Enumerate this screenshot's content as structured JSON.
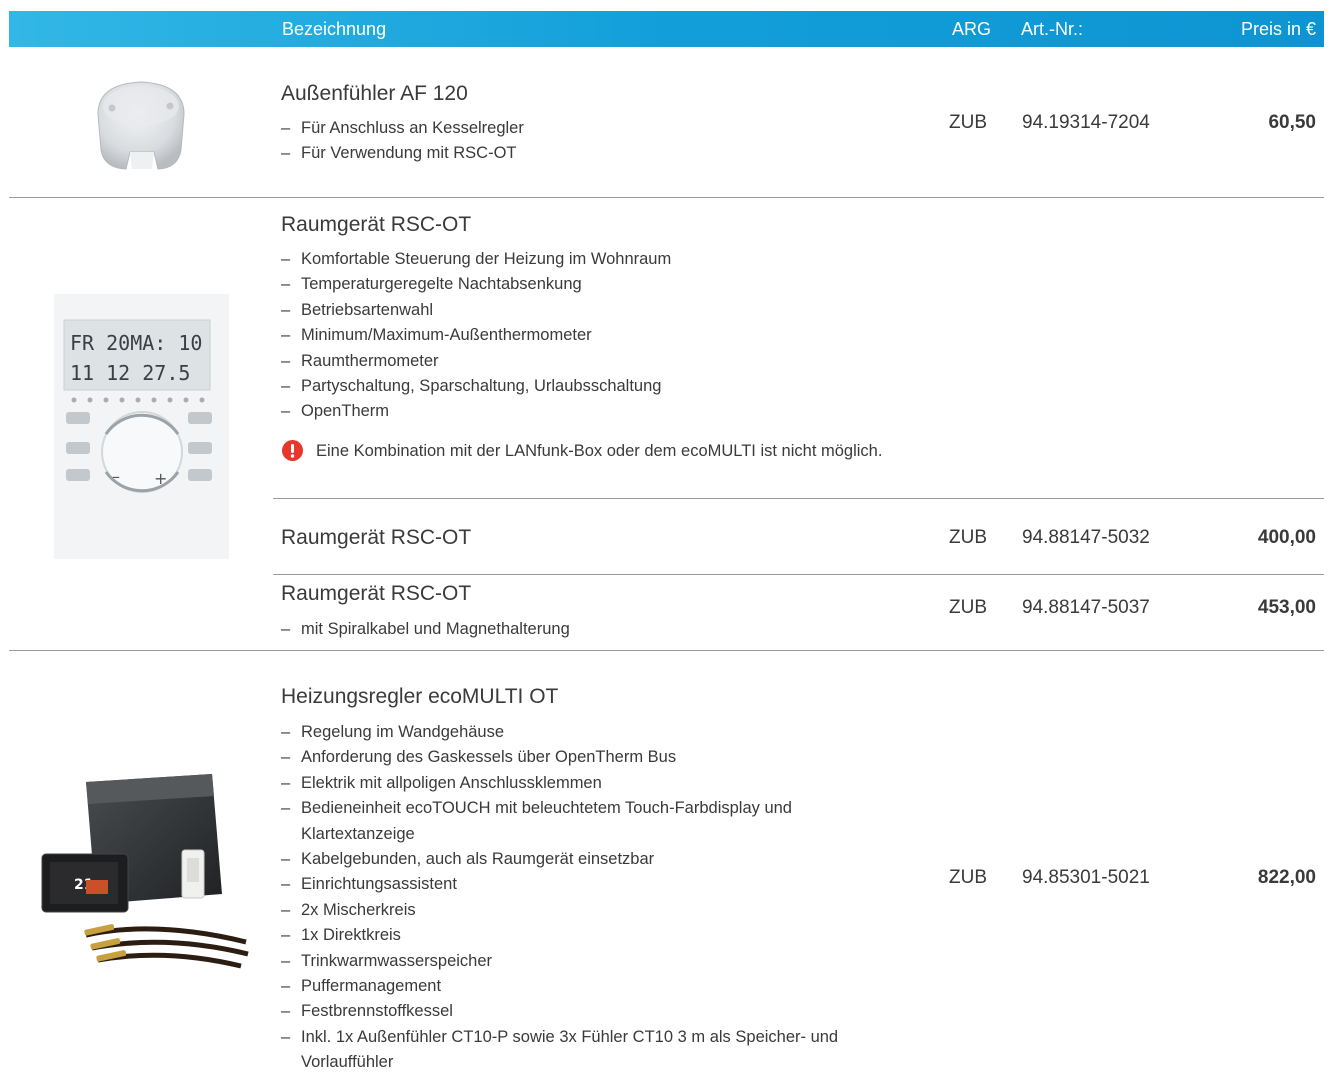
{
  "header": {
    "bezeichnung": "Bezeichnung",
    "arg": "ARG",
    "art_nr": "Art.-Nr.:",
    "preis": "Preis in €"
  },
  "products": [
    {
      "title": "Außenfühler AF 120",
      "bullets": [
        "Für Anschluss an Kesselregler",
        "Für Verwendung mit RSC-OT"
      ],
      "arg": "ZUB",
      "art_nr": "94.19314-7204",
      "price": "60,50"
    },
    {
      "title": "Raumgerät RSC-OT",
      "bullets": [
        "Komfortable Steuerung der Heizung im Wohnraum",
        "Temperaturgeregelte Nachtabsenkung",
        "Betriebsartenwahl",
        "Minimum/Maximum-Außenthermometer",
        "Raumthermometer",
        "Partyschaltung, Sparschaltung, Urlaubsschaltung",
        "OpenTherm"
      ],
      "note": "Eine Kombination mit der LANfunk-Box oder dem ecoMULTI ist nicht möglich.",
      "variants": [
        {
          "title": "Raumgerät RSC-OT",
          "arg": "ZUB",
          "art_nr": "94.88147-5032",
          "price": "400,00"
        },
        {
          "title": "Raumgerät RSC-OT",
          "sub": "mit Spiralkabel und Magnethalterung",
          "arg": "ZUB",
          "art_nr": "94.88147-5037",
          "price": "453,00"
        }
      ]
    },
    {
      "title": "Heizungsregler ecoMULTI OT",
      "bullets": [
        "Regelung im Wandgehäuse",
        "Anforderung des Gaskessels über OpenTherm Bus",
        "Elektrik mit allpoligen Anschlussklemmen",
        "Bedieneinheit ecoTOUCH mit beleuchtetem Touch-Farbdisplay und Klartextanzeige",
        "Kabelgebunden, auch als Raumgerät einsetzbar",
        "Einrichtungsassistent",
        "2x Mischerkreis",
        "1x Direktkreis",
        "Trinkwarmwasserspeicher",
        "Puffermanagement",
        "Festbrennstoffkessel",
        "Inkl. 1x Außenfühler CT10-P sowie 3x Fühler CT10 3 m als Speicher- und Vorlauffühler"
      ],
      "arg": "ZUB",
      "art_nr": "94.85301-5021",
      "price": "822,00"
    }
  ],
  "images": {
    "sensor": "sensor-image",
    "room_device": "room-device-image",
    "display_lines": [
      "FR 20MA: 10",
      "11 12    27.5"
    ],
    "controller": "controller-image",
    "touch_display_value": "21"
  },
  "colors": {
    "header": "#129fd9",
    "note_icon": "#e8362c",
    "rule": "#9a9a9a"
  }
}
